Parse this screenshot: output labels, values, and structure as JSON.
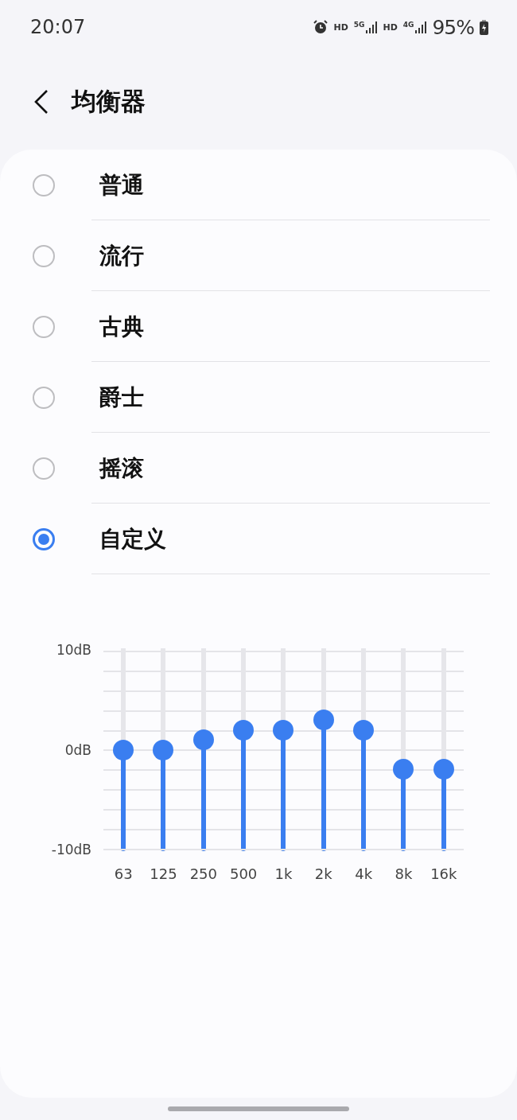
{
  "status_bar": {
    "time": "20:07",
    "network": [
      {
        "badge": "HD",
        "tech": "5G"
      },
      {
        "badge": "HD",
        "tech": "4G"
      }
    ],
    "battery": "95%"
  },
  "header": {
    "title": "均衡器"
  },
  "presets": [
    {
      "label": "普通",
      "selected": false
    },
    {
      "label": "流行",
      "selected": false
    },
    {
      "label": "古典",
      "selected": false
    },
    {
      "label": "爵士",
      "selected": false
    },
    {
      "label": "摇滚",
      "selected": false
    },
    {
      "label": "自定义",
      "selected": true
    }
  ],
  "equalizer": {
    "scale": [
      "10dB",
      "0dB",
      "-10dB"
    ],
    "bands": [
      {
        "label": "63",
        "level": 0.5
      },
      {
        "label": "125",
        "level": 0.5
      },
      {
        "label": "250",
        "level": 0.55
      },
      {
        "label": "500",
        "level": 0.6
      },
      {
        "label": "1k",
        "level": 0.6
      },
      {
        "label": "2k",
        "level": 0.65
      },
      {
        "label": "4k",
        "level": 0.6
      },
      {
        "label": "8k",
        "level": 0.4
      },
      {
        "label": "16k",
        "level": 0.4
      }
    ]
  }
}
